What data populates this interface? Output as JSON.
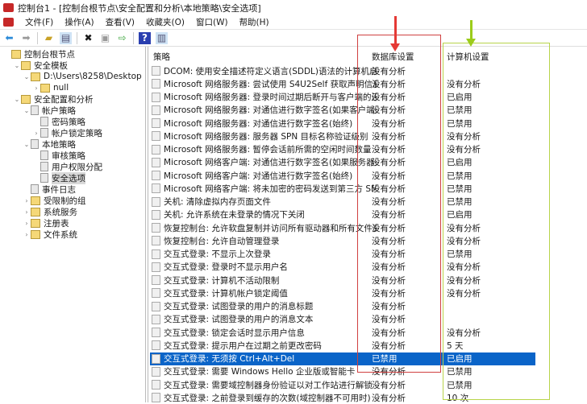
{
  "window": {
    "title": "控制台1 - [控制台根节点\\安全配置和分析\\本地策略\\安全选项]"
  },
  "menu": [
    "文件(F)",
    "操作(A)",
    "查看(V)",
    "收藏夹(O)",
    "窗口(W)",
    "帮助(H)"
  ],
  "toolbar": {
    "icons": [
      "back-icon",
      "forward-icon",
      "up-folder-icon",
      "show-tree-icon",
      "delete-icon",
      "properties-icon",
      "export-icon",
      "help-icon",
      "action-pane-icon"
    ]
  },
  "tree": [
    {
      "label": "控制台根节点",
      "level": 0,
      "exp": "",
      "icon": "folder"
    },
    {
      "label": "安全模板",
      "level": 1,
      "exp": "⌄",
      "icon": "folder"
    },
    {
      "label": "D:\\Users\\8258\\Desktop",
      "level": 2,
      "exp": "⌄",
      "icon": "folder"
    },
    {
      "label": "null",
      "level": 3,
      "exp": "›",
      "icon": "folder"
    },
    {
      "label": "安全配置和分析",
      "level": 1,
      "exp": "⌄",
      "icon": "folder"
    },
    {
      "label": "帐户策略",
      "level": 2,
      "exp": "⌄",
      "icon": "policy"
    },
    {
      "label": "密码策略",
      "level": 3,
      "exp": "",
      "icon": "policy"
    },
    {
      "label": "帐户锁定策略",
      "level": 3,
      "exp": "›",
      "icon": "policy"
    },
    {
      "label": "本地策略",
      "level": 2,
      "exp": "⌄",
      "icon": "policy"
    },
    {
      "label": "审核策略",
      "level": 3,
      "exp": "",
      "icon": "policy"
    },
    {
      "label": "用户权限分配",
      "level": 3,
      "exp": "",
      "icon": "policy"
    },
    {
      "label": "安全选项",
      "level": 3,
      "exp": "",
      "icon": "policy",
      "selected": true
    },
    {
      "label": "事件日志",
      "level": 2,
      "exp": "",
      "icon": "policy"
    },
    {
      "label": "受限制的组",
      "level": 2,
      "exp": "›",
      "icon": "folder"
    },
    {
      "label": "系统服务",
      "level": 2,
      "exp": "›",
      "icon": "folder"
    },
    {
      "label": "注册表",
      "level": 2,
      "exp": "›",
      "icon": "folder"
    },
    {
      "label": "文件系统",
      "level": 2,
      "exp": "›",
      "icon": "folder"
    }
  ],
  "columns": {
    "policy": "策略",
    "db": "数据库设置",
    "computer": "计算机设置"
  },
  "rows": [
    [
      "DCOM: 使用安全描述符定义语言(SDDL)语法的计算机启动...",
      "没有分析",
      ""
    ],
    [
      "Microsoft 网络服务器: 尝试使用 S4U2Self 获取声明信息",
      "没有分析",
      "没有分析"
    ],
    [
      "Microsoft 网络服务器: 登录时间过期后断开与客户端的连接",
      "没有分析",
      "已启用"
    ],
    [
      "Microsoft 网络服务器: 对通信进行数字签名(如果客户端允许)",
      "没有分析",
      "已禁用"
    ],
    [
      "Microsoft 网络服务器: 对通信进行数字签名(始终)",
      "没有分析",
      "已禁用"
    ],
    [
      "Microsoft 网络服务器: 服务器 SPN 目标名称验证级别",
      "没有分析",
      "没有分析"
    ],
    [
      "Microsoft 网络服务器: 暂停会话前所需的空闲时间数量",
      "没有分析",
      "没有分析"
    ],
    [
      "Microsoft 网络客户端: 对通信进行数字签名(如果服务器允许)",
      "没有分析",
      "已启用"
    ],
    [
      "Microsoft 网络客户端: 对通信进行数字签名(始终)",
      "没有分析",
      "已禁用"
    ],
    [
      "Microsoft 网络客户端: 将未加密的密码发送到第三方 SMB ...",
      "没有分析",
      "已禁用"
    ],
    [
      "关机: 清除虚拟内存页面文件",
      "没有分析",
      "已禁用"
    ],
    [
      "关机: 允许系统在未登录的情况下关闭",
      "没有分析",
      "已启用"
    ],
    [
      "恢复控制台: 允许软盘复制并访问所有驱动器和所有文件夹",
      "没有分析",
      "没有分析"
    ],
    [
      "恢复控制台: 允许自动管理登录",
      "没有分析",
      "没有分析"
    ],
    [
      "交互式登录: 不显示上次登录",
      "没有分析",
      "已禁用"
    ],
    [
      "交互式登录: 登录时不显示用户名",
      "没有分析",
      "没有分析"
    ],
    [
      "交互式登录: 计算机不活动限制",
      "没有分析",
      "没有分析"
    ],
    [
      "交互式登录: 计算机帐户锁定阈值",
      "没有分析",
      "没有分析"
    ],
    [
      "交互式登录: 试图登录的用户的消息标题",
      "没有分析",
      ""
    ],
    [
      "交互式登录: 试图登录的用户的消息文本",
      "没有分析",
      ""
    ],
    [
      "交互式登录: 锁定会话时显示用户信息",
      "没有分析",
      "没有分析"
    ],
    [
      "交互式登录: 提示用户在过期之前更改密码",
      "没有分析",
      "5 天"
    ],
    [
      "交互式登录: 无须按 Ctrl+Alt+Del",
      "已禁用",
      "已启用"
    ],
    [
      "交互式登录: 需要 Windows Hello 企业版或智能卡",
      "没有分析",
      "已禁用"
    ],
    [
      "交互式登录: 需要域控制器身份验证以对工作站进行解锁",
      "没有分析",
      "已禁用"
    ],
    [
      "交互式登录: 之前登录到缓存的次数(域控制器不可用时)",
      "没有分析",
      "10 次"
    ]
  ],
  "selected_row": 22,
  "colors": {
    "selection": "#0a64c8",
    "annotation_red": "#e53935",
    "annotation_green": "#9ccc1a"
  }
}
